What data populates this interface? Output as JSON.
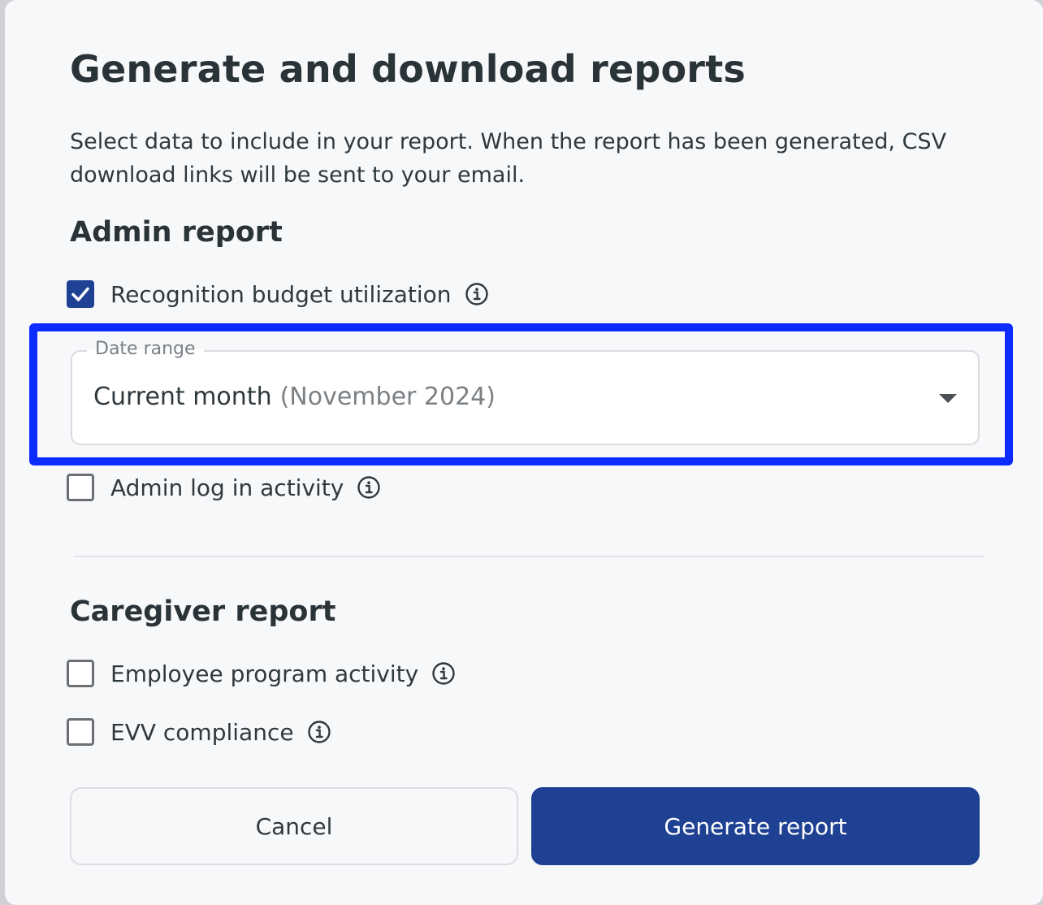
{
  "modal": {
    "title": "Generate and download reports",
    "description": "Select data to include in your report. When the report has been generated, CSV download links will be sent to your email."
  },
  "admin_report": {
    "heading": "Admin report",
    "recognition_budget": {
      "label": "Recognition budget utilization",
      "checked": true
    },
    "date_range": {
      "legend": "Date range",
      "value": "Current month",
      "hint": "(November 2024)"
    },
    "admin_login": {
      "label": "Admin log in activity",
      "checked": false
    }
  },
  "caregiver_report": {
    "heading": "Caregiver report",
    "employee_program": {
      "label": "Employee program activity",
      "checked": false
    },
    "evv_compliance": {
      "label": "EVV compliance",
      "checked": false
    }
  },
  "actions": {
    "cancel_label": "Cancel",
    "generate_label": "Generate report"
  },
  "colors": {
    "primary": "#1f4193",
    "highlight": "#0b2bff",
    "text": "#2f383d"
  }
}
